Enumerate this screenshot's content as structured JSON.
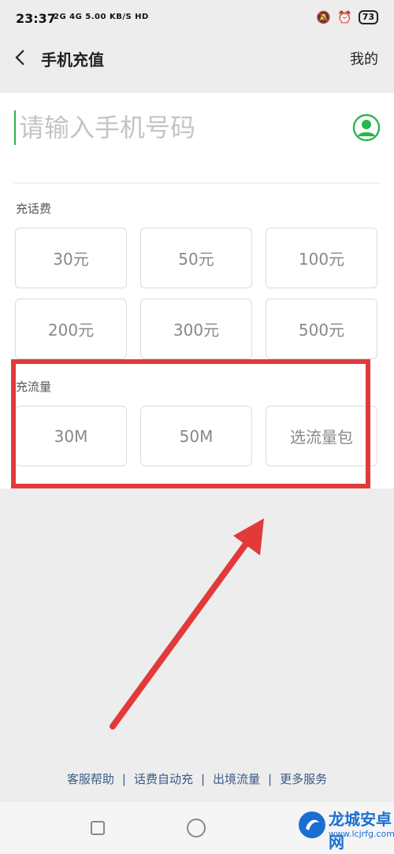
{
  "status": {
    "time": "23:37",
    "network": "2G 4G 5.00 KB/S HD",
    "battery": "73"
  },
  "header": {
    "title": "手机充值",
    "right_link": "我的"
  },
  "phone": {
    "placeholder": "请输入手机号码"
  },
  "recharge": {
    "label": "充话费",
    "options": [
      "30元",
      "50元",
      "100元",
      "200元",
      "300元",
      "500元"
    ]
  },
  "data_plan": {
    "label": "充流量",
    "options": [
      "30M",
      "50M",
      "选流量包"
    ]
  },
  "footer": {
    "links": [
      "客服帮助",
      "话费自动充",
      "出境流量",
      "更多服务"
    ]
  },
  "watermark": {
    "title": "龙城安卓网",
    "url": "www.lcjrfg.com"
  },
  "colors": {
    "accent": "#2bb54d",
    "annotation": "#e23a3a",
    "link": "#3b5a85"
  }
}
